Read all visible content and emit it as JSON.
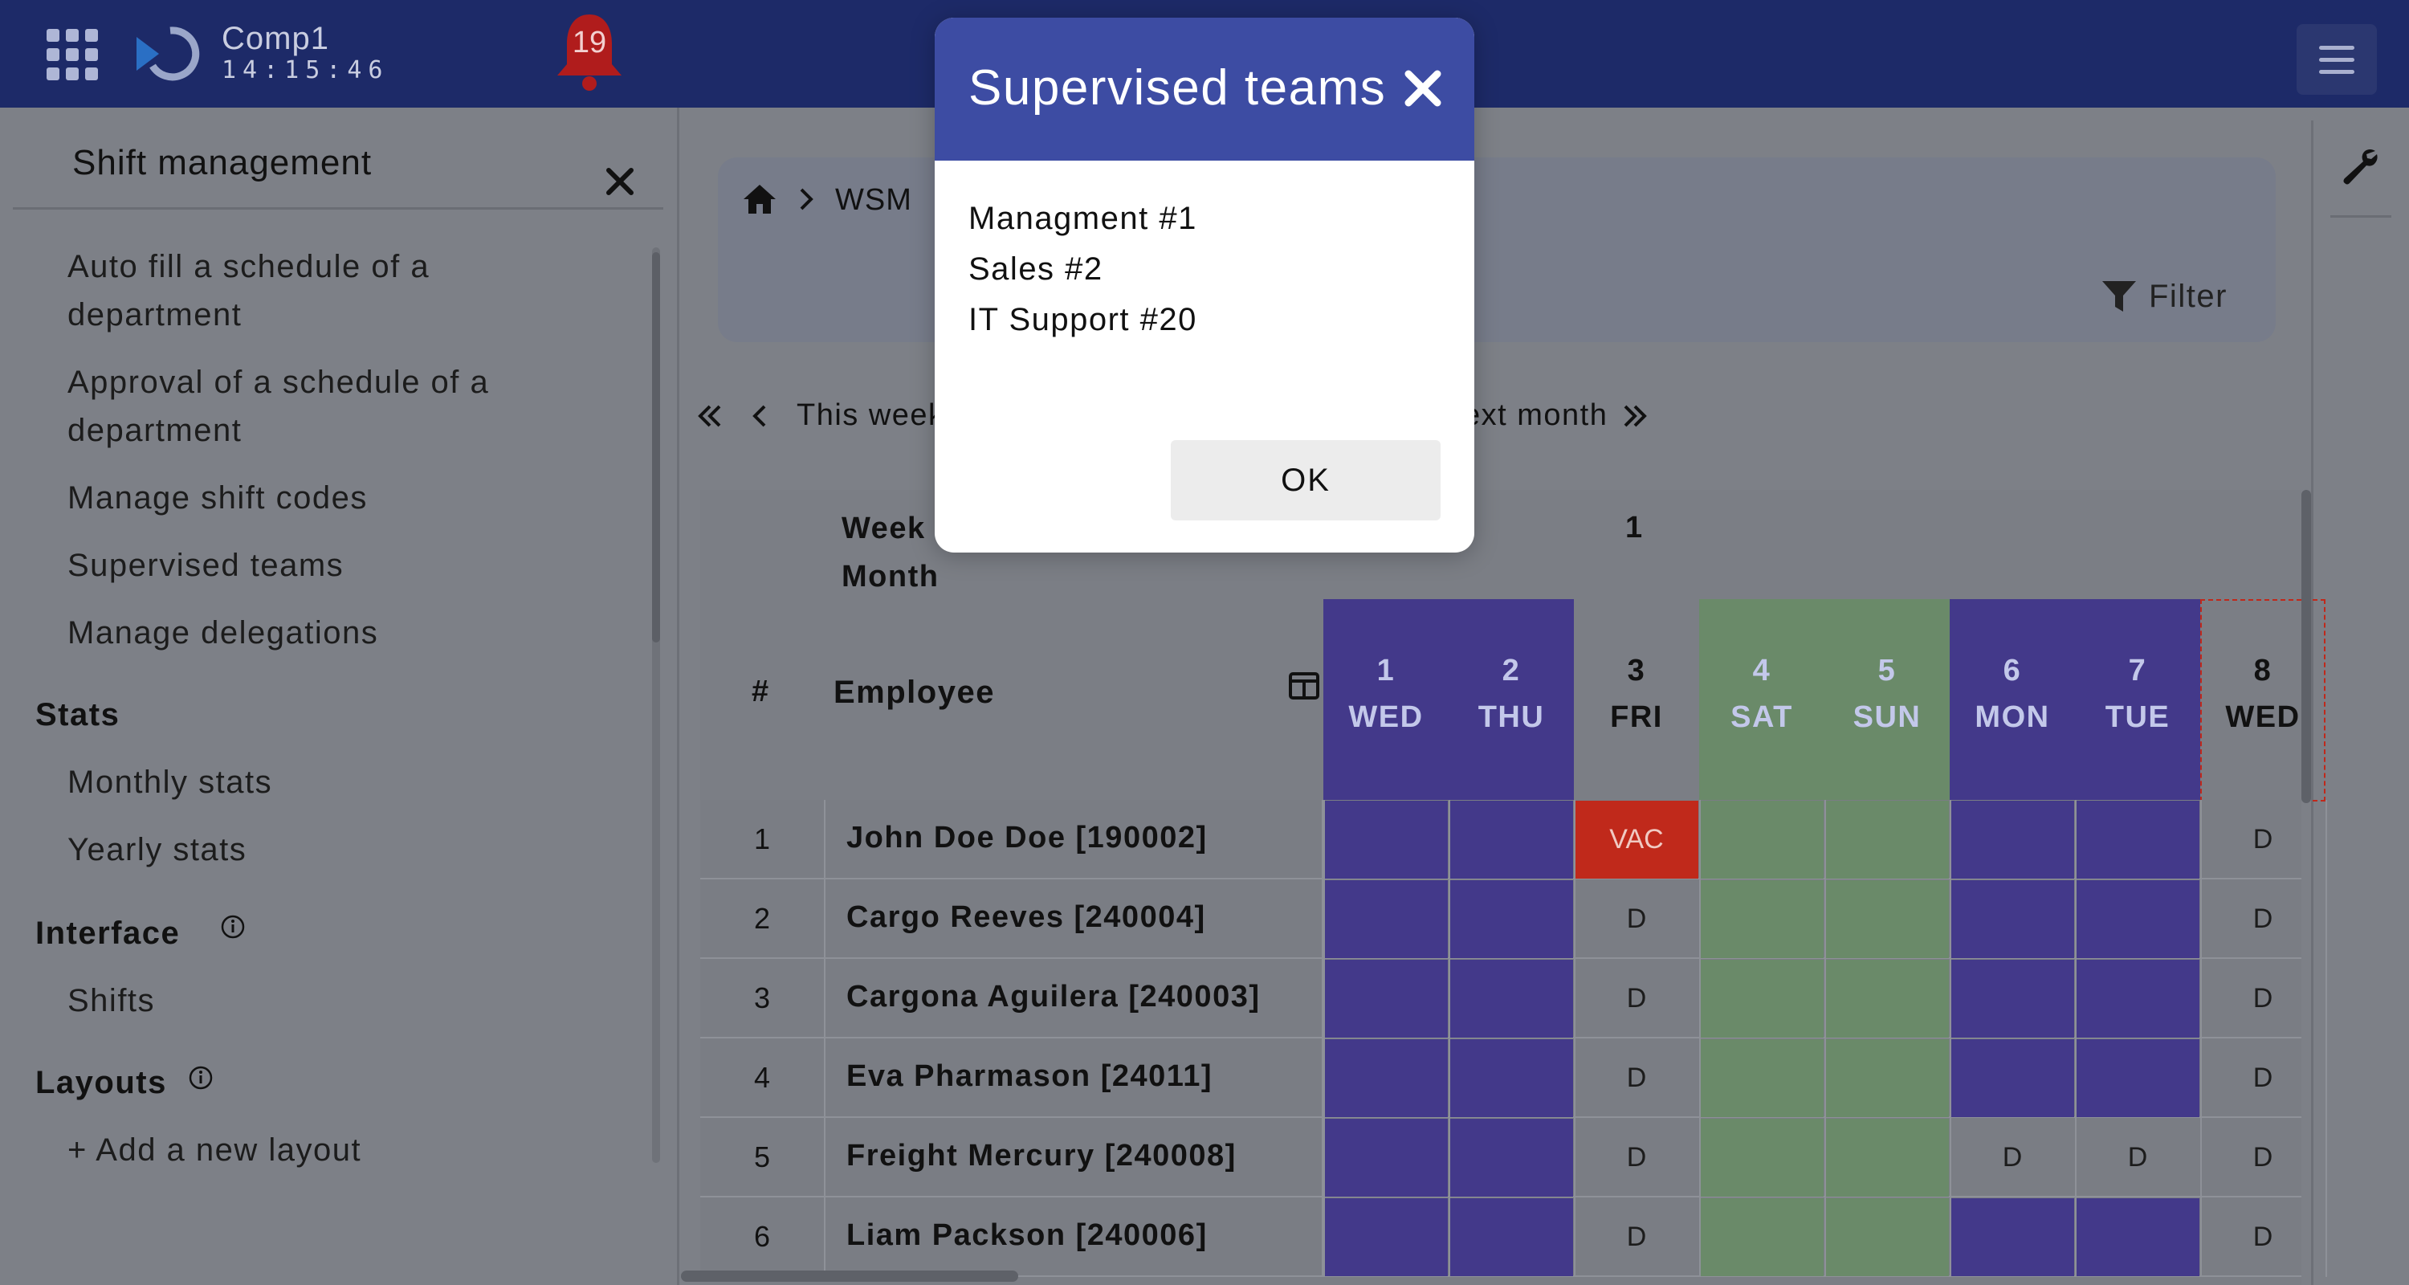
{
  "header": {
    "company": "Comp1",
    "clock": "14:15:46",
    "notification_count": "19"
  },
  "sidebar": {
    "title": "Shift management",
    "items": [
      "Auto fill a schedule of a",
      "department",
      "Approval of a schedule of a",
      "department",
      "Manage shift codes",
      "Supervised teams",
      "Manage delegations"
    ],
    "sections": {
      "stats": {
        "heading": "Stats",
        "items": [
          "Monthly stats",
          "Yearly stats"
        ]
      },
      "interface": {
        "heading": "Interface",
        "items": [
          "Shifts"
        ]
      },
      "layouts": {
        "heading": "Layouts",
        "items": [
          "+ Add a new layout"
        ]
      }
    }
  },
  "breadcrumb": {
    "item": "WSM"
  },
  "filter": {
    "label": "Filter"
  },
  "navigation": {
    "this_week": "This week",
    "next_month": "ext month"
  },
  "schedule": {
    "week_label": "Week",
    "month_label": "Month",
    "week_number": "1",
    "hash_label": "#",
    "employee_label": "Employee",
    "days": [
      {
        "num": "1",
        "name": "WED"
      },
      {
        "num": "2",
        "name": "THU"
      },
      {
        "num": "3",
        "name": "FRI"
      },
      {
        "num": "4",
        "name": "SAT"
      },
      {
        "num": "5",
        "name": "SUN"
      },
      {
        "num": "6",
        "name": "MON"
      },
      {
        "num": "7",
        "name": "TUE"
      },
      {
        "num": "8",
        "name": "WED"
      }
    ],
    "rows": [
      {
        "num": "1",
        "name": "John Doe Doe [190002]",
        "cells": [
          "",
          "",
          "VAC",
          "",
          "",
          "",
          "",
          "D"
        ]
      },
      {
        "num": "2",
        "name": "Cargo Reeves [240004]",
        "cells": [
          "",
          "",
          "D",
          "",
          "",
          "",
          "",
          "D"
        ]
      },
      {
        "num": "3",
        "name": "Cargona Aguilera [240003]",
        "cells": [
          "",
          "",
          "D",
          "",
          "",
          "",
          "",
          "D"
        ]
      },
      {
        "num": "4",
        "name": "Eva Pharmason [24011]",
        "cells": [
          "",
          "",
          "D",
          "",
          "",
          "",
          "",
          "D"
        ]
      },
      {
        "num": "5",
        "name": "Freight Mercury [240008]",
        "cells": [
          "",
          "",
          "D",
          "",
          "",
          "D",
          "D",
          "D"
        ]
      },
      {
        "num": "6",
        "name": "Liam Packson [240006]",
        "cells": [
          "",
          "",
          "D",
          "",
          "",
          "",
          "",
          "D"
        ]
      }
    ]
  },
  "modal": {
    "title": "Supervised teams",
    "lines": [
      "Managment #1",
      "Sales #2",
      "IT Support #20"
    ],
    "ok_label": "OK"
  },
  "colors": {
    "topbar": "#1d2a68",
    "modal_header": "#3d4ca3",
    "weekday_purple": "#43398a",
    "weekend_green": "#6a8a69",
    "vacation_red": "#c0291b",
    "bell_red": "#b01c1c"
  },
  "icons": [
    "apps-icon",
    "logo-icon",
    "bell-icon",
    "hamburger-icon",
    "close-icon",
    "info-icon",
    "home-icon",
    "chevron-right-icon",
    "double-chevron-left-icon",
    "chevron-left-icon",
    "double-chevron-right-icon",
    "filter-icon",
    "wrench-icon",
    "columns-icon"
  ]
}
